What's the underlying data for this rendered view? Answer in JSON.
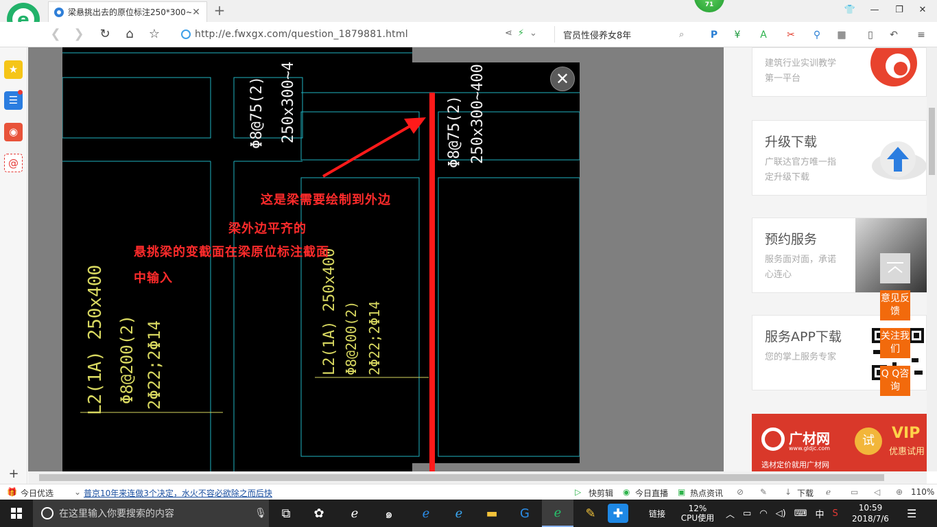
{
  "browser": {
    "tab_title": "梁悬挑出去的原位标注250*300~",
    "new_tab": "+",
    "notification_count": "71",
    "url": "http://e.fwxgx.com/question_1879881.html",
    "search_text": "官员性侵养女8年"
  },
  "page": {
    "promos": [
      {
        "title": "",
        "desc": "建筑行业实训教学第一平台"
      },
      {
        "title": "升级下载",
        "desc": "广联达官方唯一指定升级下载"
      },
      {
        "title": "预约服务",
        "desc": "服务面对面，承诺心连心"
      },
      {
        "title": "服务APP下载",
        "desc": "您的掌上服务专家"
      }
    ],
    "ad": {
      "brand": "广材网",
      "site": "www.gldjc.com",
      "badge": "试",
      "vip": "VIP",
      "vip_sub": "优惠试用",
      "bottom": "选材定价就用广材网"
    },
    "float_buttons": [
      "意见反馈",
      "关注我们",
      "Q Q咨询"
    ]
  },
  "cad": {
    "annotations": [
      "这是梁需要绘制到外边",
      "梁外边平齐的",
      "悬挑梁的变截面在梁原位标注截面",
      "中输入"
    ],
    "white_labels": [
      "Φ8@75(2)",
      "250x300~400"
    ],
    "white_labels_top": [
      "Φ8@75(2)",
      "250x300~4"
    ],
    "yellow_labels_left": [
      "L2(1A) 250x400",
      "Φ8@200(2)",
      "2Φ22;2Φ14"
    ],
    "yellow_labels_mid": [
      "L2(1A) 250x400",
      "Φ8@200(2)",
      "2Φ22;2Φ14"
    ]
  },
  "statusbar": {
    "today": "今日优选",
    "news": "普京10年来连做3个决定，水火不容必欲除之而后快",
    "items": [
      "快剪辑",
      "今日直播",
      "热点资讯"
    ],
    "download": "下载",
    "zoom": "110%"
  },
  "taskbar": {
    "search_placeholder": "在这里输入你要搜索的内容",
    "link_label": "链接",
    "cpu_percent": "12%",
    "cpu_label": "CPU使用",
    "ime": "中",
    "time": "10:59",
    "date": "2018/7/6"
  }
}
